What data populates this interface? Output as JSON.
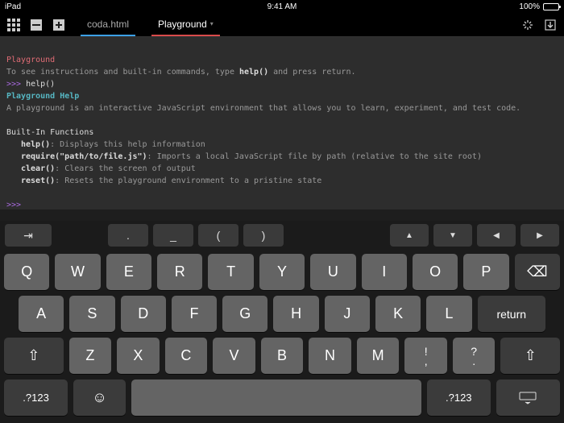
{
  "status": {
    "device": "iPad",
    "time": "9:41 AM",
    "battery": "100%"
  },
  "toolbar": {
    "tabs": {
      "file": "coda.html",
      "playground": "Playground"
    }
  },
  "console": {
    "title": "Playground",
    "intro_a": "To see instructions and built-in commands, type ",
    "intro_cmd": "help()",
    "intro_b": " and press return.",
    "prompt": ">>>",
    "typed": " help()",
    "help_title": "Playground Help",
    "help_desc": "A playground is an interactive JavaScript environment that allows you to learn, experiment, and test code.",
    "builtin_header": "Built-In Functions",
    "fn": {
      "help_n": "help()",
      "help_d": ": Displays this help information",
      "req_n": "require(\"path/to/file.js\")",
      "req_d": ": Imports a local JavaScript file by path (relative to the site root)",
      "clear_n": "clear()",
      "clear_d": ": Clears the screen of output",
      "reset_n": "reset()",
      "reset_d": ": Resets the playground environment to a pristine state"
    }
  },
  "accessory": {
    "tab": "⇥",
    "dot": ".",
    "underscore": "_",
    "lparen": "(",
    "rparen": ")",
    "up": "▲",
    "down": "▼",
    "left": "◀",
    "right": "▶"
  },
  "keys": {
    "r1": [
      "Q",
      "W",
      "E",
      "R",
      "T",
      "Y",
      "U",
      "I",
      "O",
      "P"
    ],
    "r2": [
      "A",
      "S",
      "D",
      "F",
      "G",
      "H",
      "J",
      "K",
      "L"
    ],
    "r3": [
      "Z",
      "X",
      "C",
      "V",
      "B",
      "N",
      "M"
    ],
    "backspace": "⌫",
    "return": "return",
    "shift": "⇧",
    "punct_top": "!",
    "punct_bot": ",",
    "punct2_top": "?",
    "punct2_bot": ".",
    "numbers": ".?123",
    "emoji": "☺",
    "hide": "⌨"
  }
}
